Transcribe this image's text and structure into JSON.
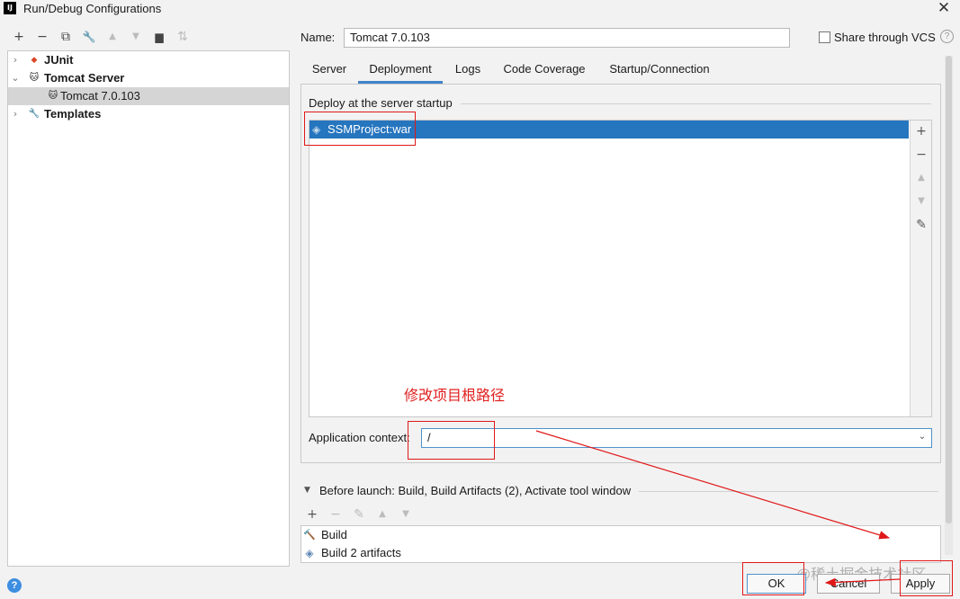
{
  "window": {
    "title": "Run/Debug Configurations",
    "logo": "IJ",
    "close_glyph": "✕"
  },
  "left_toolbar": {
    "icons": [
      "add-icon",
      "remove-icon",
      "copy-icon",
      "wrench-icon",
      "move-up-icon",
      "move-down-icon",
      "folder-add-icon",
      "sort-icon"
    ],
    "glyphs": {
      "add": "+",
      "remove": "−",
      "copy": "⧉",
      "wrench": "🔧",
      "up": "▲",
      "down": "▼",
      "folder": "▆",
      "sort": "⇅"
    }
  },
  "tree": {
    "items": [
      {
        "label": "JUnit",
        "chevron": "›",
        "icon": "◆"
      },
      {
        "label": "Tomcat Server",
        "chevron": "⌄",
        "icon": "🐱"
      },
      {
        "label": "Tomcat 7.0.103",
        "icon": "🐱"
      },
      {
        "label": "Templates",
        "chevron": "›",
        "icon": "🔧"
      }
    ]
  },
  "config": {
    "name_label": "Name:",
    "name_value": "Tomcat 7.0.103",
    "share_label": "Share through VCS",
    "help_glyph": "?"
  },
  "tabs": [
    {
      "label": "Server"
    },
    {
      "label": "Deployment",
      "active": true
    },
    {
      "label": "Logs"
    },
    {
      "label": "Code Coverage"
    },
    {
      "label": "Startup/Connection"
    }
  ],
  "deployment": {
    "section_title": "Deploy at the server startup",
    "artifacts": [
      "SSMProject:war"
    ],
    "side_buttons": {
      "add": "+",
      "remove": "−",
      "up": "▲",
      "down": "▼",
      "edit": "✎"
    },
    "annotation": "修改项目根路径",
    "app_context_label": "Application context:",
    "app_context_value": "/",
    "dropdown_glyph": "⌄"
  },
  "before_launch": {
    "toggle": "▼",
    "label": "Before launch: Build, Build Artifacts (2), Activate tool window",
    "toolbar": {
      "add": "+",
      "remove": "−",
      "edit": "✎",
      "up": "▲",
      "down": "▼"
    },
    "items": [
      {
        "label": "Build",
        "icon": "🔨"
      },
      {
        "label": "Build 2 artifacts",
        "icon": "◈"
      }
    ]
  },
  "buttons": {
    "ok": "OK",
    "cancel": "Cancel",
    "apply": "Apply",
    "help": "?"
  },
  "watermark": "@稀土掘金技术社区",
  "colors": {
    "selection": "#2675bf",
    "annotation_red": "#e01818",
    "tab_underline": "#4083c9"
  }
}
